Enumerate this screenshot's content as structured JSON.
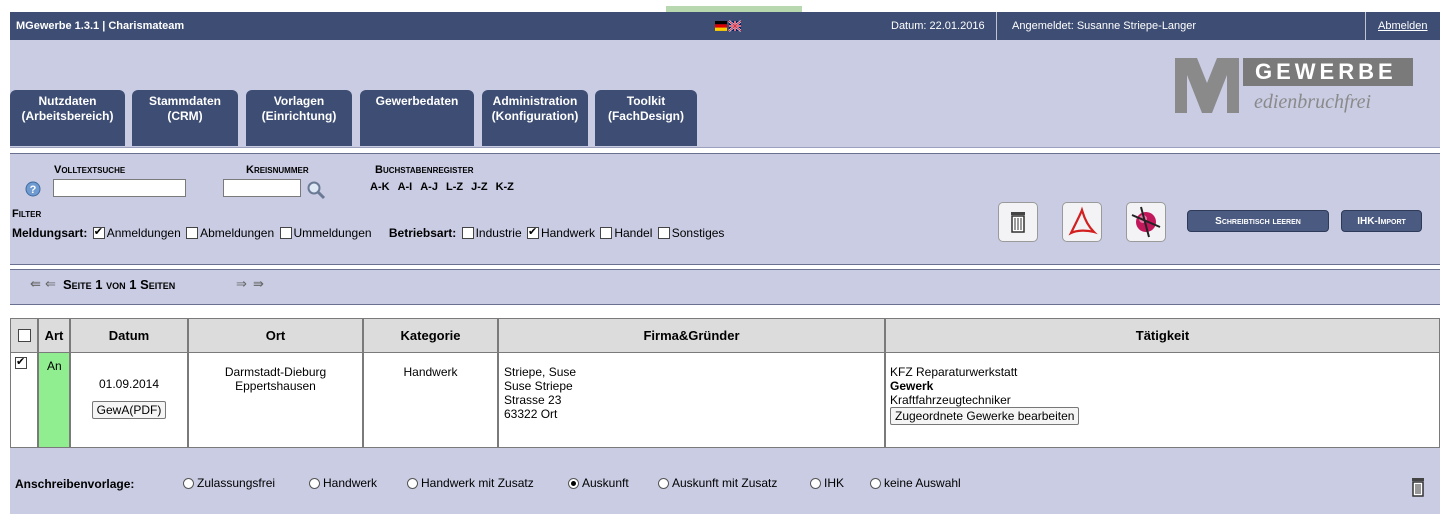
{
  "topbar": {
    "app_title": "MGewerbe 1.3.1 | Charismateam",
    "date": "Datum: 22.01.2016",
    "user": "Angemeldet: Susanne Striepe-Langer",
    "logout": "Abmelden"
  },
  "nav": [
    {
      "line1": "Nutzdaten",
      "line2": "(Arbeitsbereich)"
    },
    {
      "line1": "Stammdaten",
      "line2": "(CRM)"
    },
    {
      "line1": "Vorlagen",
      "line2": "(Einrichtung)"
    },
    {
      "line1": "Gewerbedaten",
      "line2": ""
    },
    {
      "line1": "Administration",
      "line2": "(Konfiguration)"
    },
    {
      "line1": "Toolkit",
      "line2": "(FachDesign)"
    }
  ],
  "logo": {
    "word": "GEWERBE",
    "sub": "edienbruchfrei"
  },
  "filter": {
    "fulltext_label": "Volltextsuche",
    "kreis_label": "Kreisnummer",
    "register_label": "Buchstabenregister",
    "register_links": [
      "A-K",
      "A-I",
      "A-J",
      "L-Z",
      "J-Z",
      "K-Z"
    ],
    "filter_label": "Filter",
    "meldungsart_label": "Meldungsart:",
    "meldungsart": [
      {
        "label": "Anmeldungen",
        "checked": true
      },
      {
        "label": "Abmeldungen",
        "checked": false
      },
      {
        "label": "Ummeldungen",
        "checked": false
      }
    ],
    "betriebsart_label": "Betriebsart:",
    "betriebsart": [
      {
        "label": "Industrie",
        "checked": false
      },
      {
        "label": "Handwerk",
        "checked": true
      },
      {
        "label": "Handel",
        "checked": false
      },
      {
        "label": "Sonstiges",
        "checked": false
      }
    ],
    "clear_desk": "Schreibtisch leeren",
    "ihk_import": "IHK-Import"
  },
  "pager": {
    "text": "Seite 1 von 1 Seiten"
  },
  "table": {
    "headers": [
      "Art",
      "Datum",
      "Ort",
      "Kategorie",
      "Firma&Gründer",
      "Tätigkeit"
    ],
    "row": {
      "checked": true,
      "art": "An",
      "datum": "01.09.2014",
      "pdf_button": "GewA(PDF)",
      "ort_line1": "Darmstadt-Dieburg",
      "ort_line2": "Eppertshausen",
      "kategorie": "Handwerk",
      "firma": [
        "Striepe, Suse",
        "Suse Striepe",
        "Strasse 23",
        "63322 Ort"
      ],
      "taetigkeit_line1": "KFZ Reparaturwerkstatt",
      "taetigkeit_gewerk": "Gewerk",
      "taetigkeit_line3": "Kraftfahrzeugtechniker",
      "gewerke_button": "Zugeordnete Gewerke bearbeiten"
    }
  },
  "footer": {
    "label": "Anschreibenvorlage:",
    "options": [
      {
        "label": "Zulassungsfrei",
        "selected": false
      },
      {
        "label": "Handwerk",
        "selected": false
      },
      {
        "label": "Handwerk mit Zusatz",
        "selected": false
      },
      {
        "label": "Auskunft",
        "selected": true
      },
      {
        "label": "Auskunft mit Zusatz",
        "selected": false
      },
      {
        "label": "IHK",
        "selected": false
      },
      {
        "label": "keine Auswahl",
        "selected": false
      }
    ]
  },
  "colors": {
    "nav": "#3d4d73",
    "panel": "#c9cce3",
    "art_cell": "#90ee90"
  }
}
